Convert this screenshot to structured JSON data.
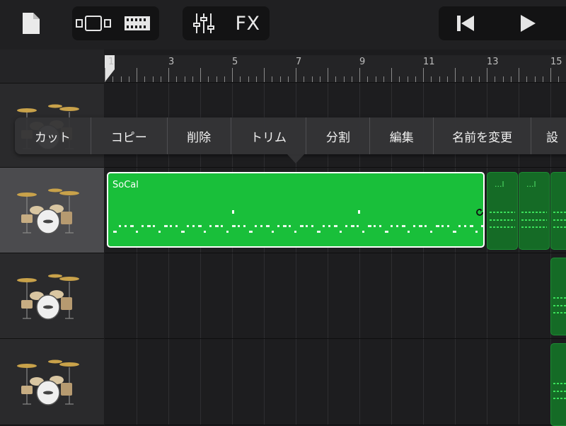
{
  "toolbar": {
    "icons": [
      "document-icon",
      "tracks-view-icon",
      "live-loops-icon",
      "mixer-icon",
      "rewind-icon",
      "play-icon"
    ],
    "fx_label": "FX"
  },
  "ruler": {
    "bars": [
      "1",
      "3",
      "5",
      "7",
      "9",
      "11",
      "13",
      "15"
    ]
  },
  "tracks": [
    {
      "instrument": "drum-kit"
    },
    {
      "instrument": "drum-kit",
      "selected": true
    },
    {
      "instrument": "drum-kit"
    },
    {
      "instrument": "drum-kit"
    }
  ],
  "region": {
    "name": "SoCal"
  },
  "mini_regions": [
    {
      "label": "...l"
    },
    {
      "label": "...l"
    }
  ],
  "context_menu": {
    "items": [
      "カット",
      "コピー",
      "削除",
      "トリム",
      "分割",
      "編集",
      "名前を変更",
      "設"
    ]
  },
  "colors": {
    "region_green": "#19bf3a",
    "region_dark_green": "#156b26",
    "background": "#1c1c1e"
  }
}
